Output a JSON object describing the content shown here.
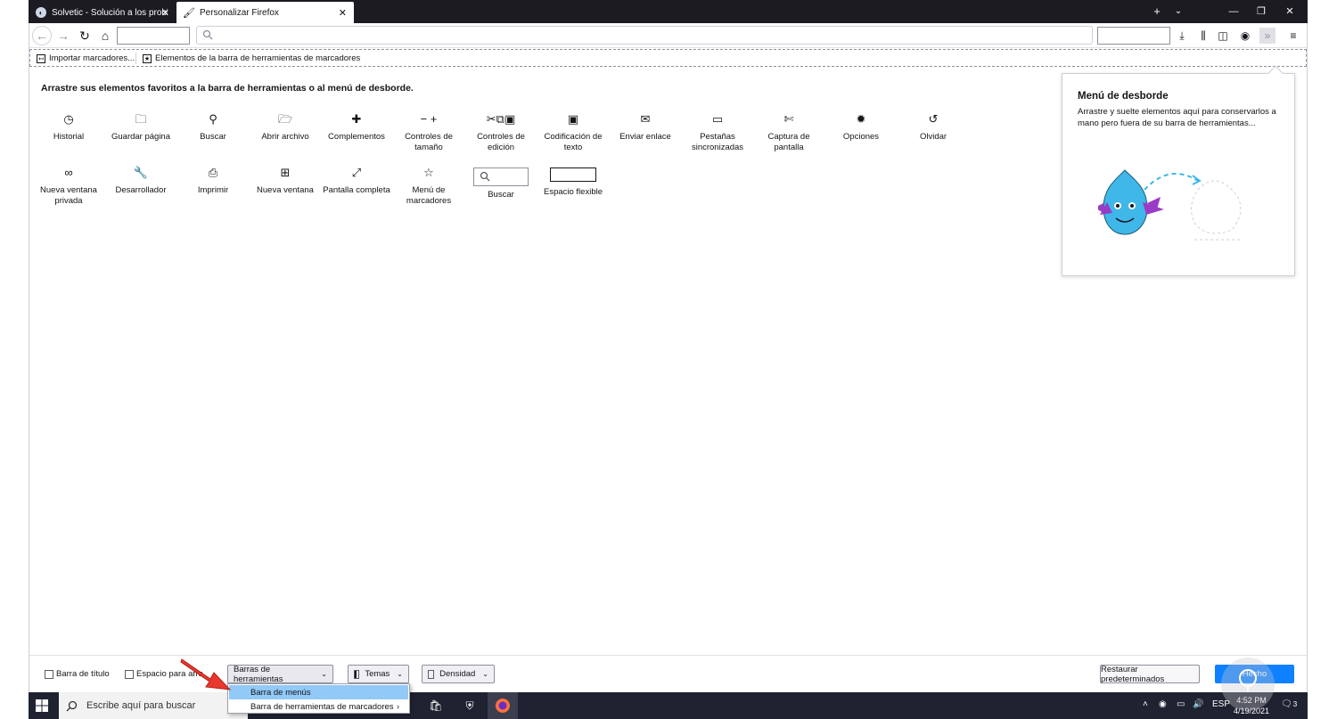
{
  "tabs": [
    {
      "title": "Solvetic - Solución a los proble",
      "icon": "solvetic-icon"
    },
    {
      "title": "Personalizar Firefox",
      "icon": "brush-icon"
    }
  ],
  "bookmarks": {
    "import_label": "Importar marcadores...",
    "toolbar_items_label": "Elementos de la barra de herramientas de marcadores"
  },
  "customize": {
    "instructions": "Arrastre sus elementos favoritos a la barra de herramientas o al menú de desborde.",
    "palette_row1": [
      {
        "label": "Historial",
        "icon": "history-icon",
        "glyph": "◷"
      },
      {
        "label": "Guardar página",
        "icon": "save-page-icon",
        "glyph": "🗀"
      },
      {
        "label": "Buscar",
        "icon": "search-icon",
        "glyph": "⚲"
      },
      {
        "label": "Abrir archivo",
        "icon": "open-file-icon",
        "glyph": "🗁"
      },
      {
        "label": "Complementos",
        "icon": "addons-icon",
        "glyph": "✚"
      },
      {
        "label": "Controles de tamaño",
        "icon": "zoom-controls-icon",
        "glyph": "− +"
      },
      {
        "label": "Controles de edición",
        "icon": "edit-controls-icon",
        "glyph": "✂⧉▣"
      },
      {
        "label": "Codificación de texto",
        "icon": "text-encoding-icon",
        "glyph": "▣"
      },
      {
        "label": "Enviar enlace",
        "icon": "email-link-icon",
        "glyph": "✉"
      },
      {
        "label": "Pestañas sincronizadas",
        "icon": "synced-tabs-icon",
        "glyph": "▭"
      },
      {
        "label": "Captura de pantalla",
        "icon": "screenshot-icon",
        "glyph": "✄"
      },
      {
        "label": "Opciones",
        "icon": "gear-icon",
        "glyph": "✹"
      },
      {
        "label": "Olvidar",
        "icon": "forget-icon",
        "glyph": "↺"
      }
    ],
    "palette_row2": [
      {
        "label": "Nueva ventana privada",
        "icon": "private-window-icon",
        "glyph": "∞"
      },
      {
        "label": "Desarrollador",
        "icon": "wrench-icon",
        "glyph": "🔧"
      },
      {
        "label": "Imprimir",
        "icon": "print-icon",
        "glyph": "⎙"
      },
      {
        "label": "Nueva ventana",
        "icon": "new-window-icon",
        "glyph": "⊞"
      },
      {
        "label": "Pantalla completa",
        "icon": "fullscreen-icon",
        "glyph": "⤢"
      },
      {
        "label": "Menú de marcadores",
        "icon": "bookmarks-menu-icon",
        "glyph": "☆"
      },
      {
        "label": "Buscar",
        "icon": "search-icon",
        "glyph": ""
      },
      {
        "label": "Espacio flexible",
        "icon": "",
        "glyph": ""
      }
    ]
  },
  "overflow_panel": {
    "title": "Menú de desborde",
    "description": "Arrastre y suelte elementos aquí para conservarlos a mano pero fuera de su barra de herramientas..."
  },
  "bottom_bar": {
    "title_bar_label": "Barra de título",
    "drag_space_label": "Espacio para arra",
    "toolbars_label": "Barras de herramientas",
    "themes_label": "Temas",
    "density_label": "Densidad",
    "restore_label": "Restaurar predeterminados",
    "done_label": "Hecho"
  },
  "toolbars_menu": {
    "items": [
      {
        "label": "Barra de menús"
      },
      {
        "label": "Barra de herramientas de marcadores"
      }
    ]
  },
  "taskbar": {
    "search_placeholder": "Escribe aquí para buscar",
    "language": "ESP",
    "time": "4:52 PM",
    "date": "4/19/2021",
    "notifications": "3"
  },
  "colors": {
    "accent": "#0f80ff",
    "menu_highlight": "#91c9f7",
    "tabstrip": "#1c1b22",
    "taskbar": "#1f2231"
  }
}
